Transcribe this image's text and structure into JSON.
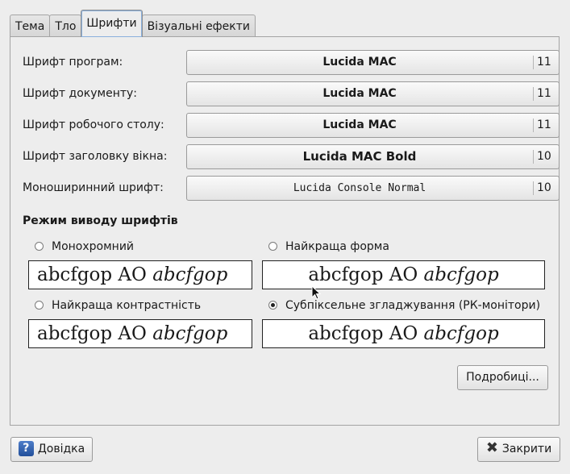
{
  "tabs": [
    "Тема",
    "Тло",
    "Шрифти",
    "Візуальні ефекти"
  ],
  "active_tab": "Шрифти",
  "fonts": [
    {
      "label": "Шрифт програм:",
      "font": "Lucida MAC",
      "size": "11"
    },
    {
      "label": "Шрифт документу:",
      "font": "Lucida MAC",
      "size": "11"
    },
    {
      "label": "Шрифт робочого столу:",
      "font": "Lucida MAC",
      "size": "11"
    },
    {
      "label": "Шрифт заголовку вікна:",
      "font": "Lucida MAC Bold",
      "size": "10"
    },
    {
      "label": "Моноширинний шрифт:",
      "font": "Lucida Console Normal",
      "size": "10"
    }
  ],
  "render_section_title": "Режим виводу шрифтів",
  "render_modes": [
    {
      "label": "Монохромний",
      "selected": false
    },
    {
      "label": "Найкраща форма",
      "selected": false
    },
    {
      "label": "Найкраща контрастність",
      "selected": false
    },
    {
      "label": "Субпіксельне згладжування (РК-монітори)",
      "selected": true
    }
  ],
  "preview_text": {
    "regular": "abcfgop AO ",
    "italic": "abcfgop"
  },
  "details_button": "Подробиці...",
  "help_button": "Довідка",
  "close_button": "Закрити",
  "icons": {
    "help": "help-icon",
    "close": "close-icon"
  }
}
